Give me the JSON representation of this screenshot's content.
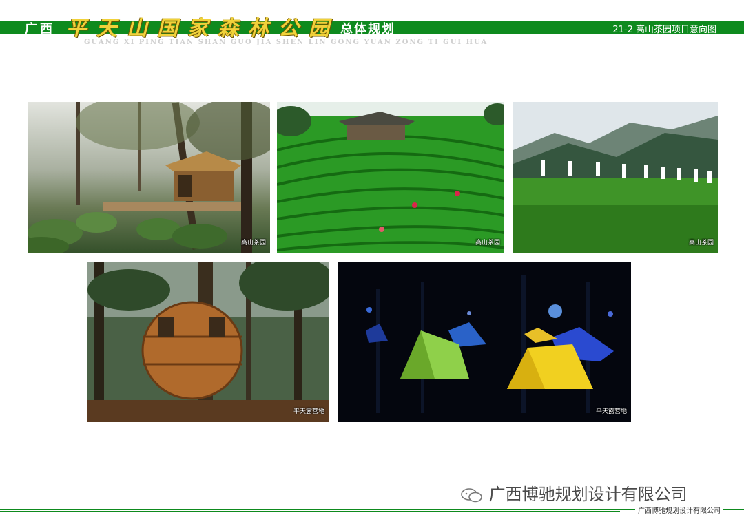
{
  "header": {
    "title_prefix": "广西",
    "title_main": "平天山国家森林公园",
    "title_suffix": "总体规划",
    "pinyin": "GUANG XI PING TIAN SHAN GUO JIA SHEN LIN GONG YUAN ZONG TI GUI HUA",
    "section": "21-2  高山茶园项目意向图"
  },
  "photos": [
    {
      "caption": "高山茶园"
    },
    {
      "caption": "高山茶园"
    },
    {
      "caption": "高山茶园"
    },
    {
      "caption": "平天露营地"
    },
    {
      "caption": "平天露营地"
    }
  ],
  "footer": {
    "watermark": "广西博驰规划设计有限公司",
    "company": "广西博驰规划设计有限公司"
  },
  "colors": {
    "brand_green": "#0e8a1e",
    "title_gold": "#f1d23a"
  }
}
